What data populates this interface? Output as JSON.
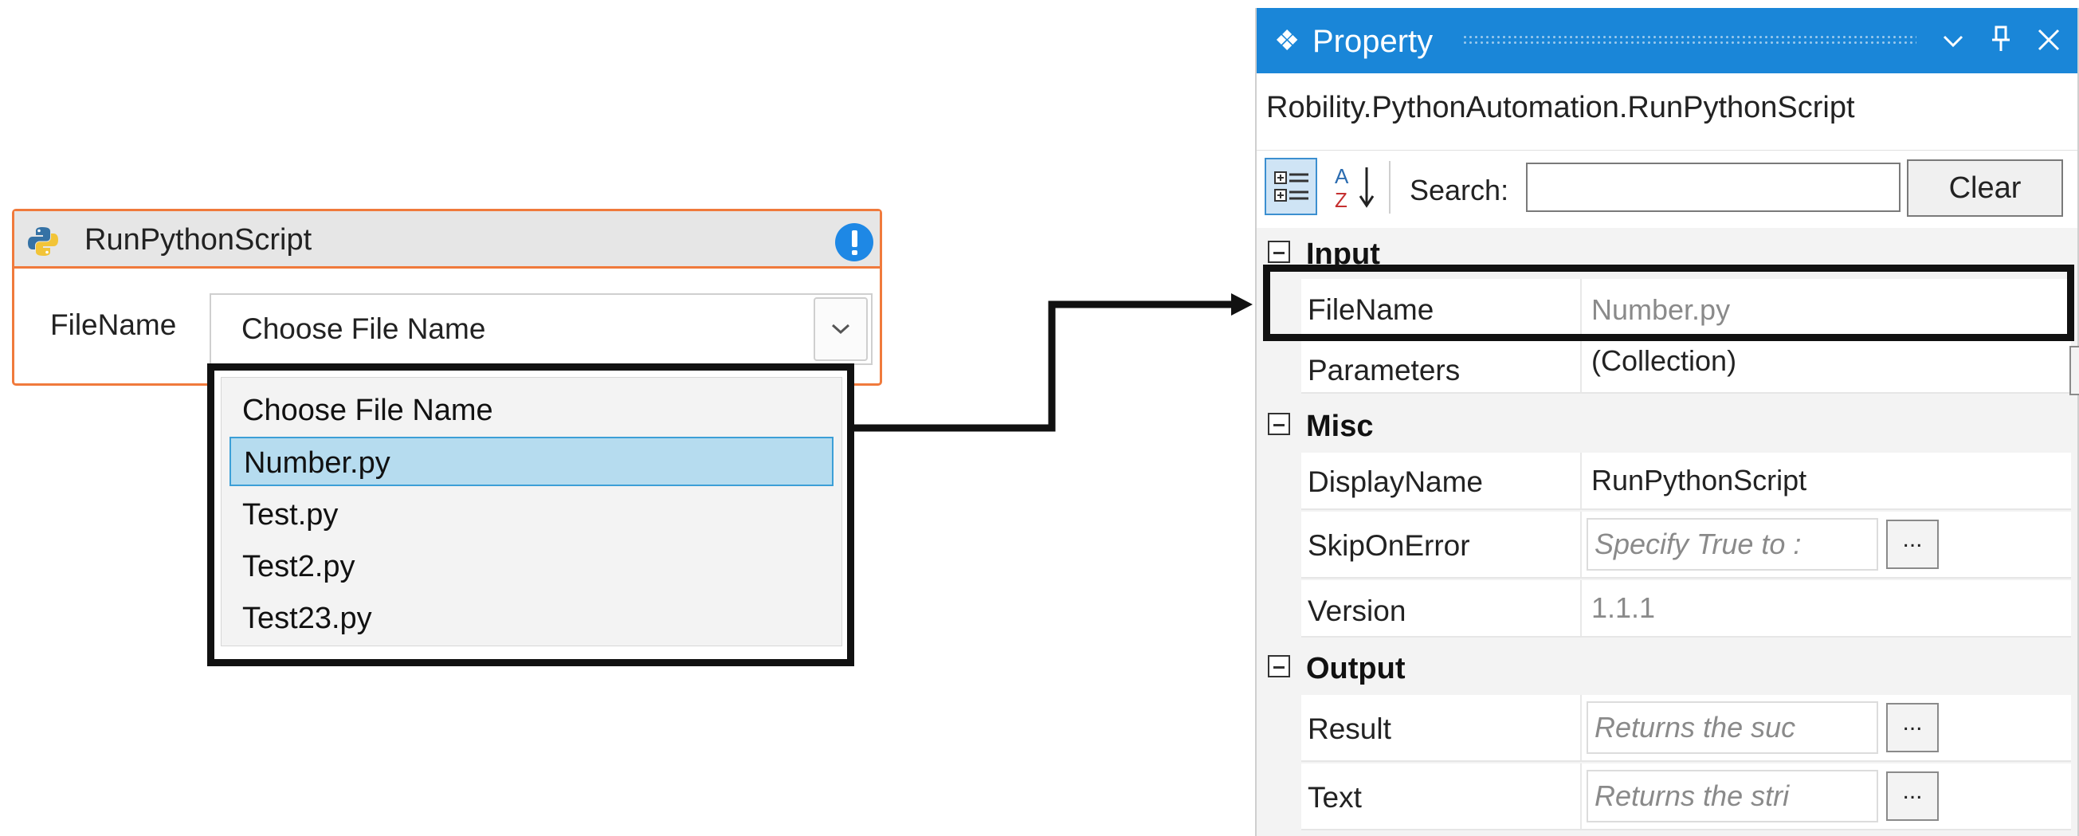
{
  "activity": {
    "title": "RunPythonScript",
    "field_label": "FileName",
    "combo_value": "Choose File Name"
  },
  "dropdown": {
    "options": [
      "Choose File Name",
      "Number.py",
      "Test.py",
      "Test2.py",
      "Test23.py"
    ],
    "selected": "Number.py"
  },
  "panel": {
    "title": "Property",
    "glyph": "❖",
    "type_name": "Robility.PythonAutomation.RunPythonScript",
    "search_label": "Search:",
    "search_value": "",
    "clear_label": "Clear",
    "categories": {
      "input": "Input",
      "misc": "Misc",
      "output": "Output"
    },
    "props": {
      "filename": {
        "name": "FileName",
        "value": "Number.py"
      },
      "parameters": {
        "name": "Parameters",
        "value": "(Collection)"
      },
      "displayname": {
        "name": "DisplayName",
        "value": "RunPythonScript"
      },
      "skiponerror": {
        "name": "SkipOnError",
        "placeholder": "Specify True to :"
      },
      "version": {
        "name": "Version",
        "value": "1.1.1"
      },
      "result": {
        "name": "Result",
        "placeholder": "Returns the suc"
      },
      "text": {
        "name": "Text",
        "placeholder": "Returns the stri"
      }
    },
    "ellipsis": "..."
  },
  "colors": {
    "activity_border": "#f07a3c",
    "titlebar": "#1a86d8",
    "selection": "#b6dcef",
    "info_icon": "#1e88e5"
  }
}
